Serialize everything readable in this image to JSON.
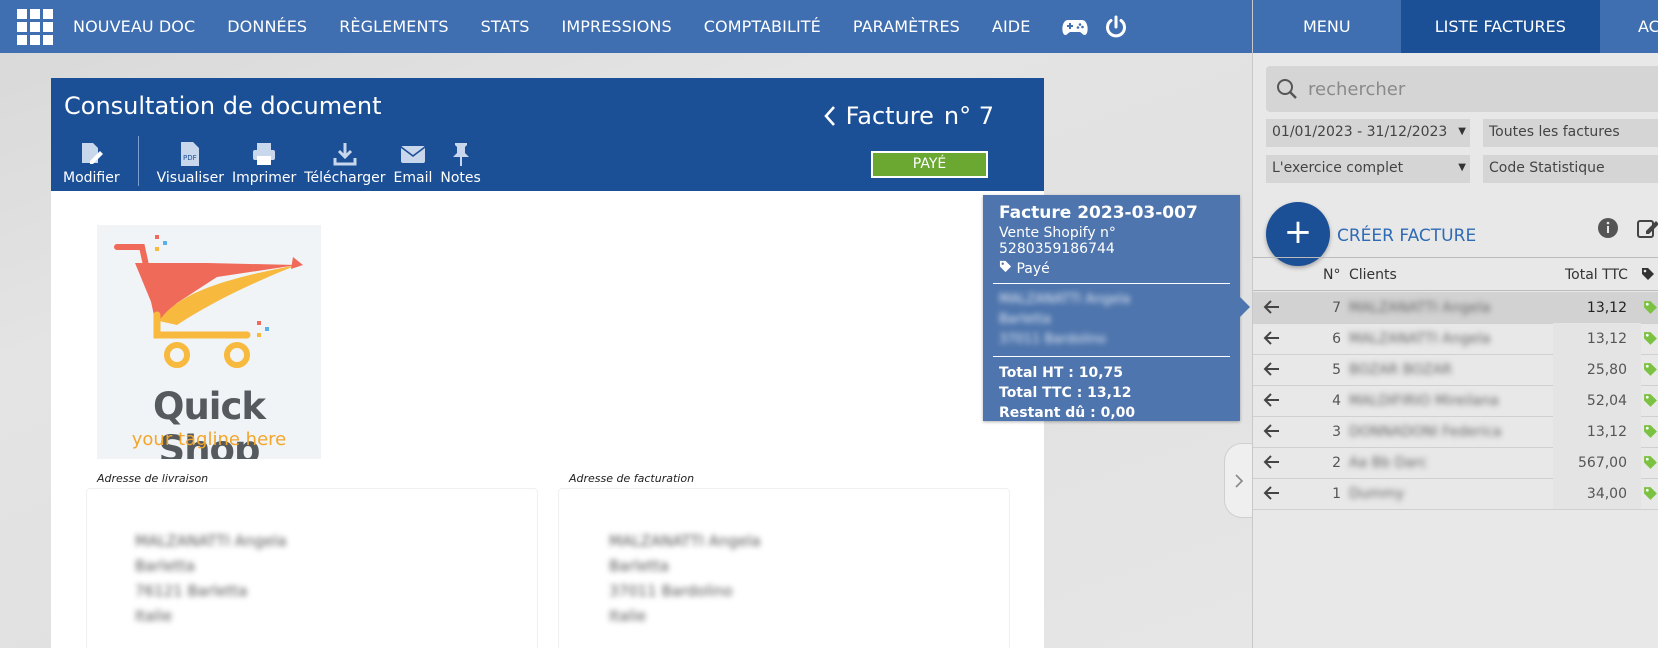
{
  "nav": {
    "items": [
      "NOUVEAU DOC",
      "DONNÉES",
      "RÈGLEMENTS",
      "STATS",
      "IMPRESSIONS",
      "COMPTABILITÉ",
      "PARAMÈTRES",
      "AIDE"
    ]
  },
  "doc": {
    "title": "Consultation de document",
    "invoice_label": "Facture",
    "invoice_number": "n° 7",
    "status": "PAYÉ",
    "toolbar": {
      "modifier": "Modifier",
      "visualiser": "Visualiser",
      "imprimer": "Imprimer",
      "telecharger": "Télécharger",
      "email": "Email",
      "notes": "Notes"
    },
    "logo": {
      "title": "Quick Shop",
      "tagline": "your tagline here"
    },
    "shipping_label": "Adresse de livraison",
    "billing_label": "Adresse de facturation",
    "shipping_address": [
      "MALZANATTI Angela",
      "Barletta",
      "76121 Barletta",
      "Italie"
    ],
    "billing_address": [
      "MALZANATTI Angela",
      "Barletta",
      "37011 Bardolino",
      "Italie"
    ]
  },
  "tooltip": {
    "title": "Facture 2023-03-007",
    "subtitle": "Vente Shopify n° 5280359186744",
    "status": "Payé",
    "address": [
      "MALZANATTI Angela",
      "Barletta",
      "37011 Bardolino"
    ],
    "total_ht": "Total HT : 10,75",
    "total_ttc": "Total TTC : 13,12",
    "restant": "Restant dû : 0,00"
  },
  "panel": {
    "tabs": [
      "MENU",
      "LISTE FACTURES",
      "AC"
    ],
    "search_placeholder": "rechercher",
    "filters": {
      "period": "01/01/2023 - 31/12/2023",
      "type": "Toutes les factures",
      "exercise": "L'exercice complet",
      "stat_code": "Code Statistique"
    },
    "create_label": "CRÉER FACTURE",
    "columns": {
      "num": "N°",
      "client": "Clients",
      "total": "Total TTC"
    },
    "rows": [
      {
        "num": "7",
        "client": "MALZANATTI Angela",
        "total": "13,12"
      },
      {
        "num": "6",
        "client": "MALZANATTI Angela",
        "total": "13,12"
      },
      {
        "num": "5",
        "client": "BOZAR BOZAR",
        "total": "25,80"
      },
      {
        "num": "4",
        "client": "MALDIFIRIO Mireilana",
        "total": "52,04"
      },
      {
        "num": "3",
        "client": "DONNADONI Federica",
        "total": "13,12"
      },
      {
        "num": "2",
        "client": "Aa Bb Darc",
        "total": "567,00"
      },
      {
        "num": "1",
        "client": "Dummy",
        "total": "34,00"
      }
    ]
  },
  "colors": {
    "nav_blue": "#3f6fb0",
    "header_blue": "#1b4f96",
    "paid_green": "#6aa832",
    "tag_green": "#7cc242"
  }
}
